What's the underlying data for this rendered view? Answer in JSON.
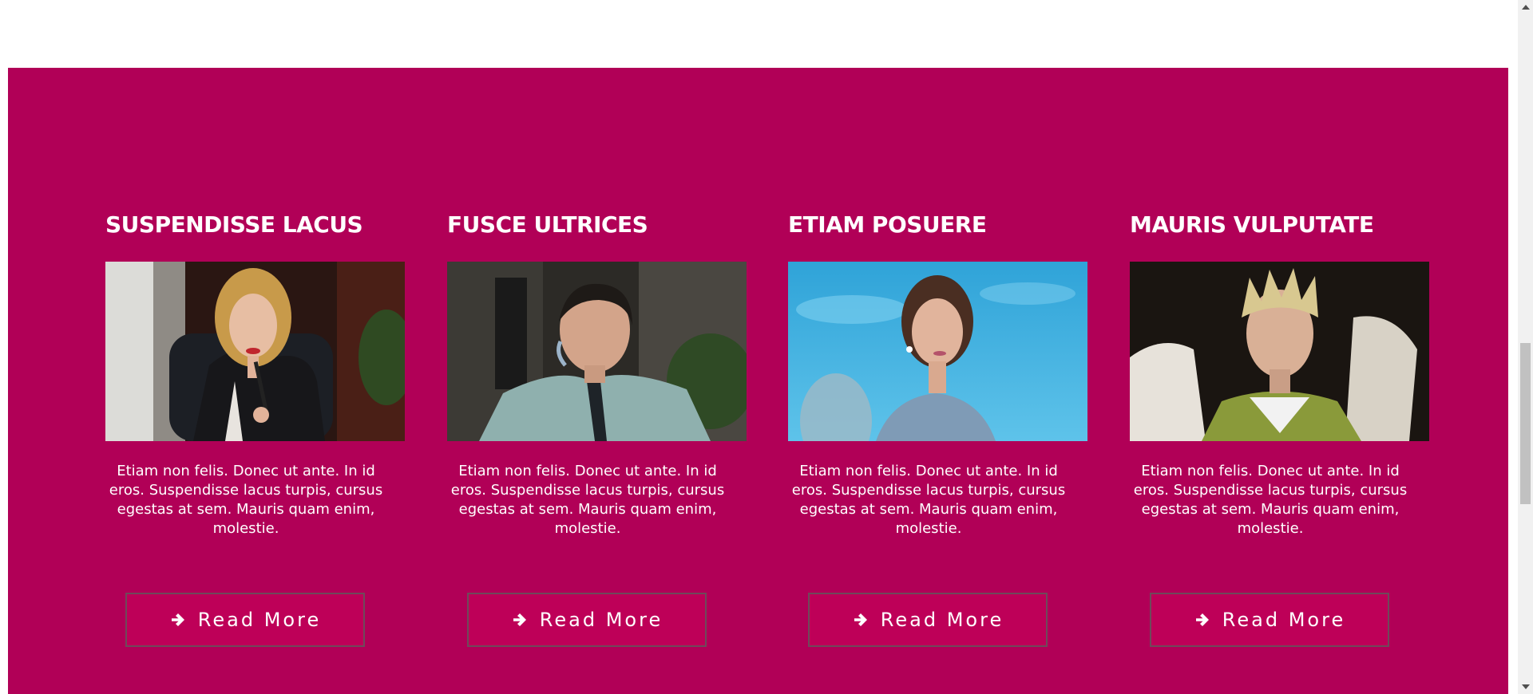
{
  "colors": {
    "section_background": "#b10057",
    "button_background": "#be0058",
    "button_border": "#6e4a5a",
    "text": "#ffffff"
  },
  "cards": [
    {
      "title": "SUSPENDISSE LACUS",
      "image_alt": "Businesswoman in black office chair holding a pen",
      "text": "Etiam non felis. Donec ut ante. In id eros. Suspendisse lacus turpis, cursus egestas at sem. Mauris quam enim, molestie.",
      "button_icon": "arrow-right-icon",
      "button_label": "Read More"
    },
    {
      "title": "FUSCE ULTRICES",
      "image_alt": "Man with headset wearing shirt and tie",
      "text": "Etiam non felis. Donec ut ante. In id eros. Suspendisse lacus turpis, cursus egestas at sem. Mauris quam enim, molestie.",
      "button_icon": "arrow-right-icon",
      "button_label": "Read More"
    },
    {
      "title": "ETIAM POSUERE",
      "image_alt": "Woman in front of a blue sky",
      "text": "Etiam non felis. Donec ut ante. In id eros. Suspendisse lacus turpis, cursus egestas at sem. Mauris quam enim, molestie.",
      "button_icon": "arrow-right-icon",
      "button_label": "Read More"
    },
    {
      "title": "MAURIS VULPUTATE",
      "image_alt": "Young man with spiky blond hair",
      "text": "Etiam non felis. Donec ut ante. In id eros. Suspendisse lacus turpis, cursus egestas at sem. Mauris quam enim, molestie.",
      "button_icon": "arrow-right-icon",
      "button_label": "Read More"
    }
  ],
  "scrollbar": {
    "thumb_position": 0.49
  }
}
